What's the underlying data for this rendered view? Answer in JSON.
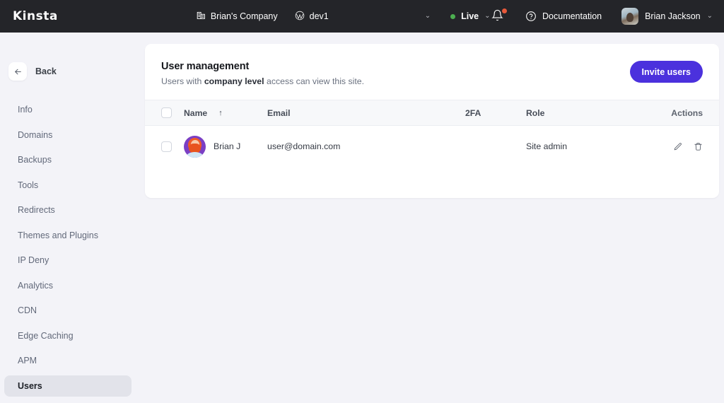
{
  "topbar": {
    "logo": "Kinsta",
    "company": {
      "label": "Brian's Company",
      "icon": "company-building-icon"
    },
    "site": {
      "label": "dev1",
      "icon": "wordpress-icon"
    },
    "chevron": "⌄",
    "environment": {
      "label": "Live",
      "status_color": "#4caf50",
      "chevron": "⌄"
    },
    "notifications": {
      "icon": "bell-icon",
      "badge_color": "#e8593a",
      "has_badge": true
    },
    "documentation": {
      "label": "Documentation",
      "icon": "question-circle-icon"
    },
    "user": {
      "name": "Brian Jackson",
      "chevron": "⌄"
    }
  },
  "sidebar": {
    "back": {
      "label": "Back",
      "icon": "arrow-left-icon"
    },
    "items": [
      {
        "label": "Info",
        "active": false
      },
      {
        "label": "Domains",
        "active": false
      },
      {
        "label": "Backups",
        "active": false
      },
      {
        "label": "Tools",
        "active": false
      },
      {
        "label": "Redirects",
        "active": false
      },
      {
        "label": "Themes and Plugins",
        "active": false
      },
      {
        "label": "IP Deny",
        "active": false
      },
      {
        "label": "Analytics",
        "active": false
      },
      {
        "label": "CDN",
        "active": false
      },
      {
        "label": "Edge Caching",
        "active": false
      },
      {
        "label": "APM",
        "active": false
      },
      {
        "label": "Users",
        "active": true
      }
    ]
  },
  "main": {
    "title": "User management",
    "subtitle_pre": "Users with ",
    "subtitle_bold": "company level",
    "subtitle_post": " access can view this site.",
    "invite_button": "Invite users",
    "accent_color": "#4b31dd",
    "table": {
      "columns": {
        "name": "Name",
        "name_sort": "↑",
        "email": "Email",
        "twofa": "2FA",
        "role": "Role",
        "actions": "Actions"
      },
      "rows": [
        {
          "name": "Brian J",
          "email": "user@domain.com",
          "twofa": "",
          "role": "Site admin",
          "edit_icon": "pencil-icon",
          "delete_icon": "trash-icon"
        }
      ]
    }
  }
}
